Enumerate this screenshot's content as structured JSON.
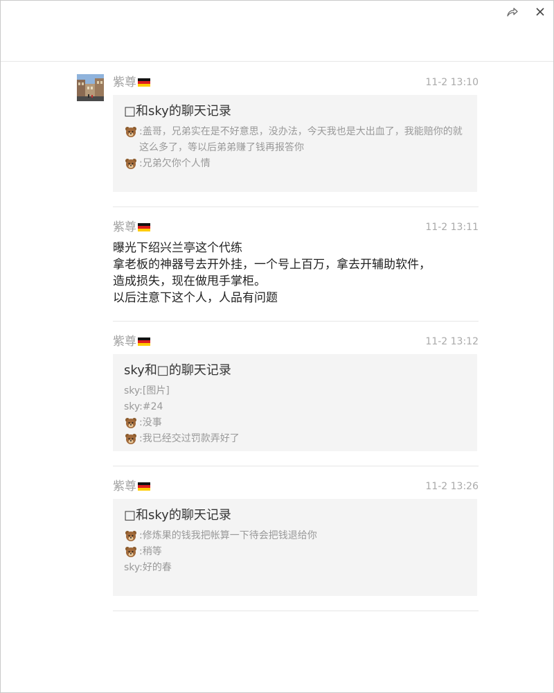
{
  "titlebar": {
    "share_icon": "share-icon",
    "close_icon": "close-icon"
  },
  "messages": [
    {
      "sender": "紫尊",
      "time": "11-2 13:10",
      "card": {
        "title": "□和sky的聊天记录",
        "lines": [
          {
            "avatar": "bear-emoji",
            "text": ":盖哥，兄弟实在是不好意思，没办法，今天我也是大出血了，我能赔你的就这么多了，等以后弟弟赚了钱再报答你"
          },
          {
            "avatar": "bear-emoji",
            "text": ":兄弟欠你个人情"
          }
        ]
      }
    },
    {
      "sender": "紫尊",
      "time": "11-2 13:11",
      "text_lines": [
        "曝光下绍兴兰亭这个代练",
        "拿老板的神器号去开外挂，一个号上百万，拿去开辅助软件，",
        "造成损失，现在做甩手掌柜。",
        "以后注意下这个人，人品有问题"
      ]
    },
    {
      "sender": "紫尊",
      "time": "11-2 13:12",
      "card": {
        "title": "sky和□的聊天记录",
        "lines": [
          {
            "avatar": "",
            "text": "sky:[图片]"
          },
          {
            "avatar": "",
            "text": "sky:#24"
          },
          {
            "avatar": "bear-emoji",
            "text": ":没事"
          },
          {
            "avatar": "bear-emoji",
            "text": ":我已经交过罚款弄好了"
          }
        ]
      }
    },
    {
      "sender": "紫尊",
      "time": "11-2 13:26",
      "card": {
        "title": "□和sky的聊天记录",
        "lines": [
          {
            "avatar": "bear-emoji",
            "text": ":修炼果的钱我把帐算一下待会把钱退给你"
          },
          {
            "avatar": "bear-emoji",
            "text": ":稍等"
          },
          {
            "avatar": "",
            "text": "sky:好的春"
          }
        ]
      }
    }
  ]
}
